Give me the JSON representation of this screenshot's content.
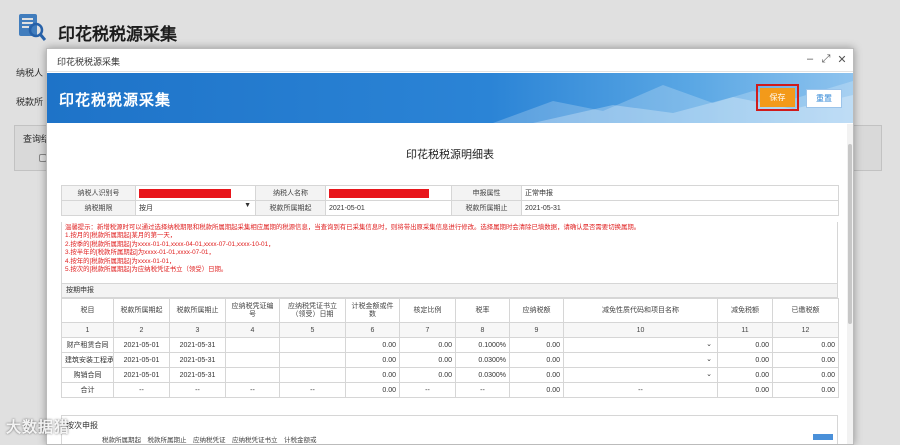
{
  "background": {
    "title": "印花税税源采集",
    "label_taxpayer": "纳税人",
    "label_period": "税款所",
    "label_query": "查询结"
  },
  "modal": {
    "window_title": "印花税税源采集",
    "banner_title": "印花税税源采集",
    "buttons": {
      "save": "保存",
      "reset": "重置"
    },
    "win_controls": {
      "minimize": "–",
      "maximize": "⤢",
      "close": "✕"
    }
  },
  "doc": {
    "title": "印花税税源明细表",
    "info": {
      "taxpayer_id_label": "纳税人识别号",
      "taxpayer_name_label": "纳税人名称",
      "declare_attr_label": "申报属性",
      "declare_attr_value": "正常申报",
      "period_type_label": "纳税期限",
      "period_type_value": "按月",
      "period_start_label": "税款所属期起",
      "period_start_value": "2021-05-01",
      "period_end_label": "税款所属期止",
      "period_end_value": "2021-05-31"
    },
    "tips": [
      "温馨提示：新增税源时可以通过选择纳税期限和税款所属期起采集相应属期的税源信息，当查询到有已采集信息时，则将带出原采集信息进行修改。选择属期时会清除已填数据，请确认是否需要切换属期。",
      "1.按月的[税款所属期起]某月的第一天，",
      "2.按季的[税款所属期起]为xxxx-01-01,xxxx-04-01,xxxx-07-01,xxxx-10-01，",
      "3.按半年的[税款所属期起]为xxxx-01-01,xxxx-07-01，",
      "4.按年的[税款所属期起]为xxxx-01-01，",
      "5.按次的[税款所属期起]为应纳税凭证书立（领受）日期。"
    ],
    "section_label": "按期申报",
    "columns": [
      "税目",
      "税款所属期起",
      "税款所属期止",
      "应纳税凭证编号",
      "应纳税凭证书立（领受）日期",
      "计税金额或件数",
      "核定比例",
      "税率",
      "应纳税额",
      "减免性质代码和项目名称",
      "减免税额",
      "已缴税额"
    ],
    "column_numbers": [
      "1",
      "2",
      "3",
      "4",
      "5",
      "6",
      "7",
      "8",
      "9",
      "10",
      "11",
      "12"
    ],
    "rows": [
      {
        "item": "财产租赁合同",
        "start": "2021-05-01",
        "end": "2021-05-31",
        "amount": "0.00",
        "ratio": "0.00",
        "rate": "0.1000%",
        "tax": "0.00",
        "relief": "0.00",
        "paid": "0.00"
      },
      {
        "item": "建筑安装工程承",
        "start": "2021-05-01",
        "end": "2021-05-31",
        "amount": "0.00",
        "ratio": "0.00",
        "rate": "0.0300%",
        "tax": "0.00",
        "relief": "0.00",
        "paid": "0.00"
      },
      {
        "item": "购销合同",
        "start": "2021-05-01",
        "end": "2021-05-31",
        "amount": "0.00",
        "ratio": "0.00",
        "rate": "0.0300%",
        "tax": "0.00",
        "relief": "0.00",
        "paid": "0.00"
      }
    ],
    "total": {
      "label": "合计",
      "dash": "--",
      "amount": "0.00",
      "tax": "0.00",
      "relief": "0.00",
      "paid": "0.00"
    },
    "lower": {
      "heading": "按次申报",
      "cols": "税款所属期起　税款所属期止　应纳税凭证　应纳税凭证书立　计税金额或"
    }
  },
  "watermark": "大数据猎"
}
